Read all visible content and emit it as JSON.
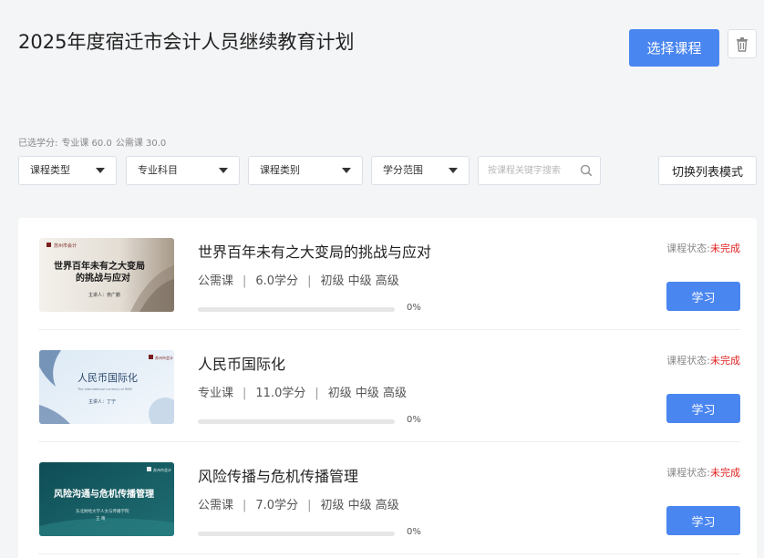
{
  "header": {
    "title": "2025年度宿迁市会计人员继续教育计划",
    "select_label": "选择课程"
  },
  "credits": {
    "label": "已选学分:",
    "professional": "专业课 60.0",
    "public": "公需课 30.0"
  },
  "filters": {
    "course_type": "课程类型",
    "subject": "专业科目",
    "category": "课程类别",
    "credit_range": "学分范围",
    "search_placeholder": "按课程关键字搜索",
    "toggle_label": "切换列表模式"
  },
  "courses": [
    {
      "title": "世界百年未有之大变局的挑战与应对",
      "type": "公需课",
      "credits": "6.0学分",
      "levels": "初级 中级 高级",
      "progress": 0,
      "progress_label": "0%",
      "status_label": "课程状态:",
      "status_value": "未完成",
      "action": "学习",
      "thumb": {
        "logo": "苏州市会计",
        "line1": "世界百年未有之大变局",
        "line2": "的挑战与应对",
        "presenter": "主讲人：奈广鹏"
      }
    },
    {
      "title": "人民币国际化",
      "type": "专业课",
      "credits": "11.0学分",
      "levels": "初级 中级 高级",
      "progress": 0,
      "progress_label": "0%",
      "status_label": "课程状态:",
      "status_value": "未完成",
      "action": "学习",
      "thumb": {
        "logo": "苏州市会计",
        "line1": "人民币国际化",
        "line2": "The international currency of RMB",
        "presenter": "主讲人：丁宁"
      }
    },
    {
      "title": "风险传播与危机传播管理",
      "type": "公需课",
      "credits": "7.0学分",
      "levels": "初级 中级 高级",
      "progress": 0,
      "progress_label": "0%",
      "status_label": "课程状态:",
      "status_value": "未完成",
      "action": "学习",
      "thumb": {
        "logo": "苏州市会计",
        "line1": "风险沟通与危机传播管理",
        "line2": "东北财经大学人文与传播学院",
        "presenter": "王 晴"
      }
    }
  ]
}
